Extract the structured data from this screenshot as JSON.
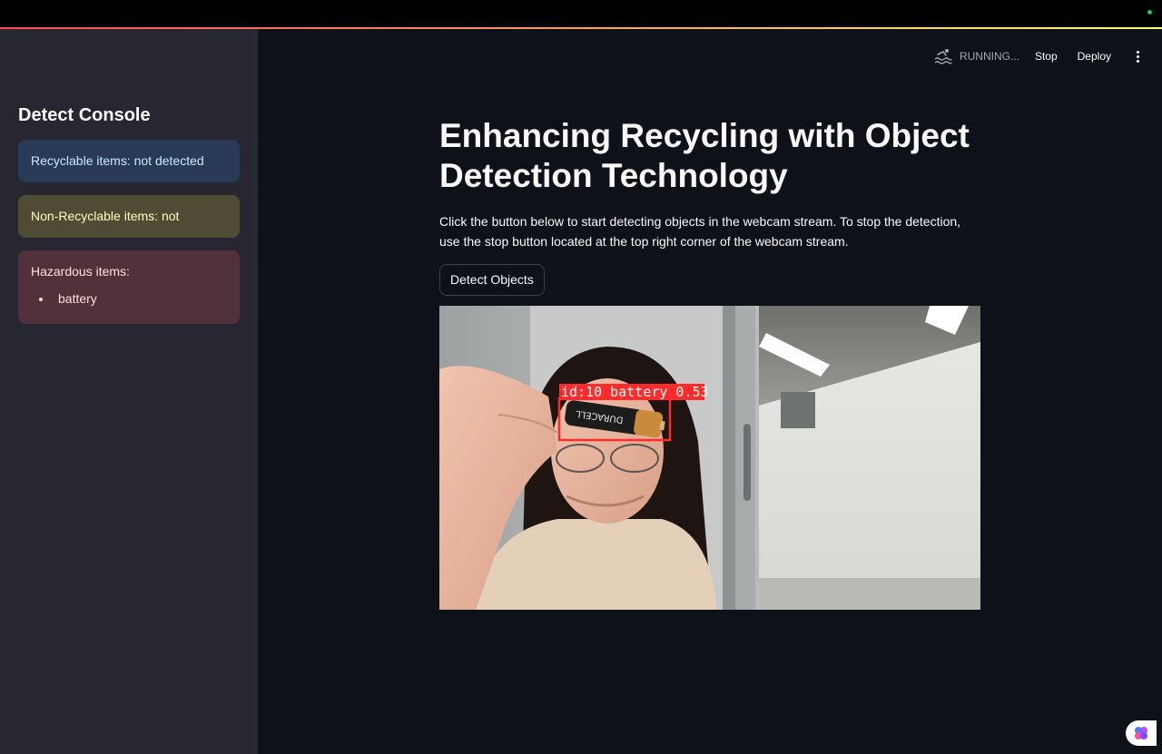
{
  "sidebar": {
    "title": "Detect Console",
    "recyclable": "Recyclable items: not detected",
    "non_recyclable": "Non-Recyclable items: not detected",
    "hazardous_title": "Hazardous items:",
    "hazardous_items": [
      "battery"
    ]
  },
  "header": {
    "status": "RUNNING...",
    "stop_label": "Stop",
    "deploy_label": "Deploy"
  },
  "main": {
    "title": "Enhancing Recycling with Object Detection Technology",
    "description": "Click the button below to start detecting objects in the webcam stream. To stop the detection, use the stop button located at the top right corner of the webcam stream.",
    "detect_button": "Detect Objects"
  },
  "stream": {
    "detection_label": "id:10 battery 0.53",
    "battery_text": "DURACELL"
  },
  "colors": {
    "accent": "#ff4b4b",
    "detection_box": "#ff2a2a",
    "running_dot": "#21c354"
  }
}
